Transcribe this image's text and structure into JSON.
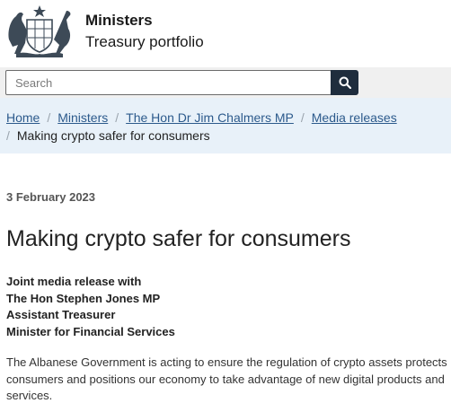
{
  "header": {
    "title": "Ministers",
    "subtitle": "Treasury portfolio",
    "crest_icon": "australian-coat-of-arms-icon"
  },
  "search": {
    "placeholder": "Search",
    "button_icon": "search-icon"
  },
  "breadcrumb": {
    "items": [
      "Home",
      "Ministers",
      "The Hon Dr Jim Chalmers MP",
      "Media releases"
    ],
    "current": "Making crypto safer for consumers"
  },
  "article": {
    "date": "3 February 2023",
    "title": "Making crypto safer for consumers",
    "joint_lines": [
      "Joint media release with",
      "The Hon Stephen Jones MP",
      "Assistant Treasurer",
      "Minister for Financial Services"
    ],
    "body_lines": [
      "The Albanese Government is acting to ensure the regulation of crypto assets protects",
      "consumers and positions our economy to take advantage of new digital products and",
      "services."
    ]
  },
  "colors": {
    "search_button": "#1f2d3d",
    "breadcrumb_bg": "#e8f1f9",
    "link": "#2c5a8c"
  }
}
